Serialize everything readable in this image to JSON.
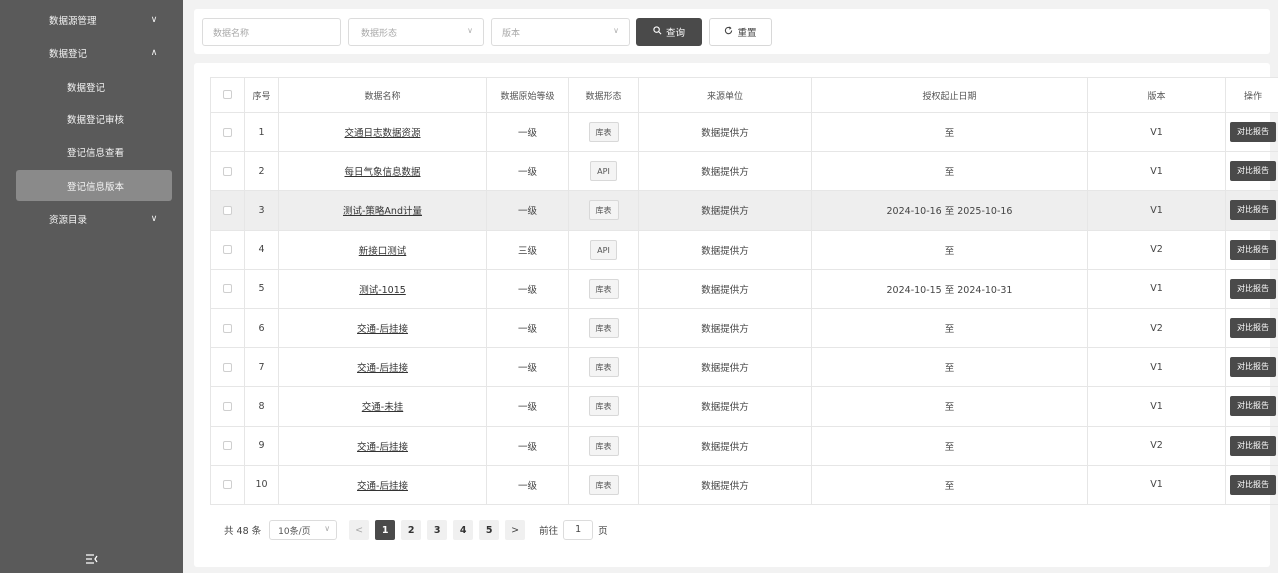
{
  "sidebar": {
    "groups": [
      {
        "label": "数据源管理",
        "chevron": "chevron-down-icon"
      },
      {
        "label": "数据登记",
        "chevron": "chevron-up-icon"
      },
      {
        "label": "资源目录",
        "chevron": "chevron-down-icon"
      }
    ],
    "sub_items": [
      {
        "label": "数据登记",
        "active": false
      },
      {
        "label": "数据登记审核",
        "active": false
      },
      {
        "label": "登记信息查看",
        "active": false
      },
      {
        "label": "登记信息版本",
        "active": true
      }
    ],
    "collapse_icon": "collapse-menu-icon"
  },
  "filters": {
    "name_placeholder": "数据名称",
    "form_placeholder": "数据形态",
    "version_placeholder": "版本",
    "query_label": "查询",
    "reset_label": "重置"
  },
  "table": {
    "headers": [
      "",
      "序号",
      "数据名称",
      "数据原始等级",
      "数据形态",
      "来源单位",
      "授权起止日期",
      "版本",
      "操作"
    ],
    "action_label": "对比报告",
    "rows": [
      {
        "no": "1",
        "name": "交通日志数据资源",
        "level": "一级",
        "form": "库表",
        "source": "数据提供方",
        "period": "至",
        "version": "V1"
      },
      {
        "no": "2",
        "name": "每日气象信息数据",
        "level": "一级",
        "form": "API",
        "source": "数据提供方",
        "period": "至",
        "version": "V1"
      },
      {
        "no": "3",
        "name": "测试-策略And计量",
        "level": "一级",
        "form": "库表",
        "source": "数据提供方",
        "period": "2024-10-16 至 2025-10-16",
        "version": "V1"
      },
      {
        "no": "4",
        "name": "新接口测试",
        "level": "三级",
        "form": "API",
        "source": "数据提供方",
        "period": "至",
        "version": "V2"
      },
      {
        "no": "5",
        "name": "测试-1015",
        "level": "一级",
        "form": "库表",
        "source": "数据提供方",
        "period": "2024-10-15 至 2024-10-31",
        "version": "V1"
      },
      {
        "no": "6",
        "name": "交通-后挂接",
        "level": "一级",
        "form": "库表",
        "source": "数据提供方",
        "period": "至",
        "version": "V2"
      },
      {
        "no": "7",
        "name": "交通-后挂接",
        "level": "一级",
        "form": "库表",
        "source": "数据提供方",
        "period": "至",
        "version": "V1"
      },
      {
        "no": "8",
        "name": "交通-未挂",
        "level": "一级",
        "form": "库表",
        "source": "数据提供方",
        "period": "至",
        "version": "V1"
      },
      {
        "no": "9",
        "name": "交通-后挂接",
        "level": "一级",
        "form": "库表",
        "source": "数据提供方",
        "period": "至",
        "version": "V2"
      },
      {
        "no": "10",
        "name": "交通-后挂接",
        "level": "一级",
        "form": "库表",
        "source": "数据提供方",
        "period": "至",
        "version": "V1"
      }
    ],
    "highlighted_row": 3
  },
  "pagination": {
    "total": "共 48 条",
    "page_size": "10条/页",
    "pages": [
      "1",
      "2",
      "3",
      "4",
      "5"
    ],
    "current": "1",
    "prev": "<",
    "next": ">",
    "goto_label": "前往",
    "goto_value": "1",
    "goto_suffix": "页"
  }
}
